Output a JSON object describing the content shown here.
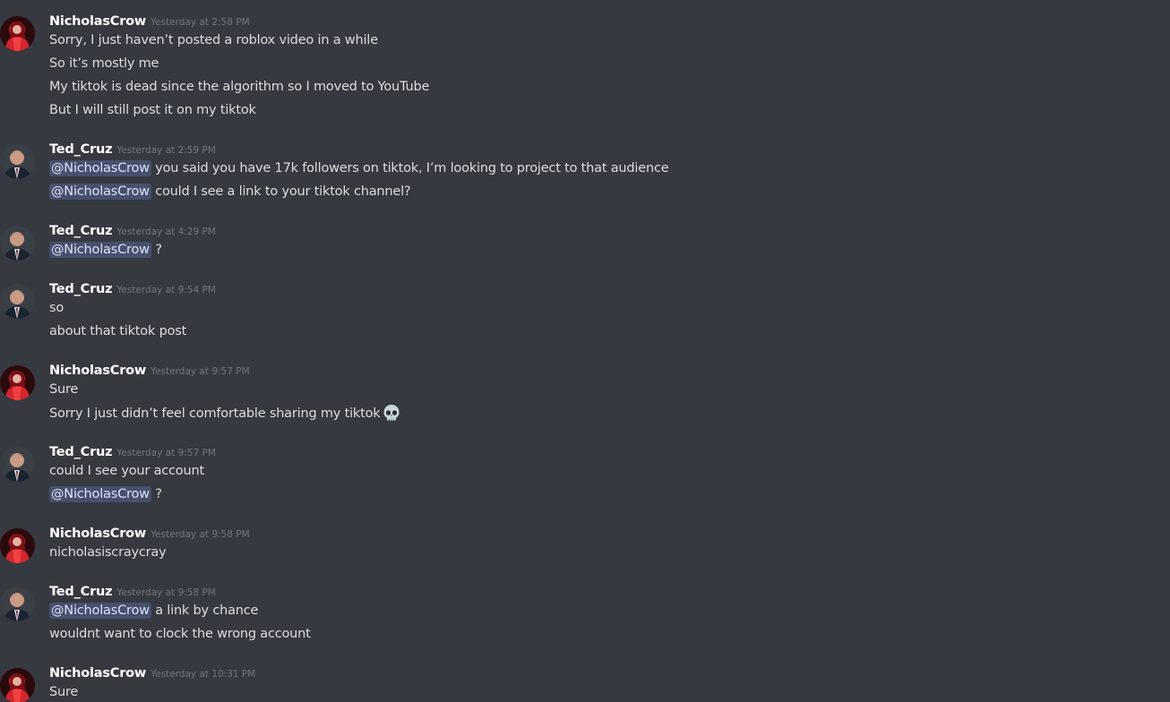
{
  "messages": [
    {
      "user": "NicholasCrow",
      "avatar": "nicholas-avatar",
      "time": "Yesterday at 2:58 PM",
      "lines": [
        {
          "text": "Sorry, I just haven’t posted a roblox video in a while"
        },
        {
          "text": "So it’s mostly me"
        },
        {
          "text": "My tiktok is dead since the algorithm so I moved to YouTube"
        },
        {
          "text": "But I will still post it on my tiktok"
        }
      ]
    },
    {
      "user": "Ted_Cruz",
      "avatar": "ted-avatar",
      "time": "Yesterday at 2:59 PM",
      "lines": [
        {
          "mention": "@NicholasCrow",
          "text": " you said you have 17k followers on tiktok, I’m looking to project to that audience"
        },
        {
          "mention": "@NicholasCrow",
          "text": " could I see a link to your tiktok channel?"
        }
      ]
    },
    {
      "user": "Ted_Cruz",
      "avatar": "ted-avatar",
      "time": "Yesterday at 4:29 PM",
      "lines": [
        {
          "mention": "@NicholasCrow",
          "text": " ?"
        }
      ]
    },
    {
      "user": "Ted_Cruz",
      "avatar": "ted-avatar",
      "time": "Yesterday at 9:54 PM",
      "lines": [
        {
          "text": "so"
        },
        {
          "text": "about that tiktok post"
        }
      ]
    },
    {
      "user": "NicholasCrow",
      "avatar": "nicholas-avatar",
      "time": "Yesterday at 9:57 PM",
      "lines": [
        {
          "text": "Sure"
        },
        {
          "text": "Sorry I just didn’t feel comfortable sharing my tiktok",
          "emoji": "skull-icon"
        }
      ]
    },
    {
      "user": "Ted_Cruz",
      "avatar": "ted-avatar",
      "time": "Yesterday at 9:57 PM",
      "lines": [
        {
          "text": "could I see your account"
        },
        {
          "mention": "@NicholasCrow",
          "text": " ?"
        }
      ]
    },
    {
      "user": "NicholasCrow",
      "avatar": "nicholas-avatar",
      "time": "Yesterday at 9:58 PM",
      "lines": [
        {
          "text": "nicholasiscraycray"
        }
      ]
    },
    {
      "user": "Ted_Cruz",
      "avatar": "ted-avatar",
      "time": "Yesterday at 9:58 PM",
      "lines": [
        {
          "mention": "@NicholasCrow",
          "text": " a link by chance"
        },
        {
          "text": "wouldnt want to clock the wrong account"
        }
      ]
    },
    {
      "user": "NicholasCrow",
      "avatar": "nicholas-avatar",
      "time": "Yesterday at 10:31 PM",
      "lines": [
        {
          "text": "Sure"
        }
      ]
    }
  ],
  "colors": {
    "background": "#36393f",
    "username": "#ffffff",
    "timestamp": "#72767d",
    "text": "#dcddde",
    "mention_bg": "#4a4f8a",
    "mention_text": "#dee0fc"
  }
}
